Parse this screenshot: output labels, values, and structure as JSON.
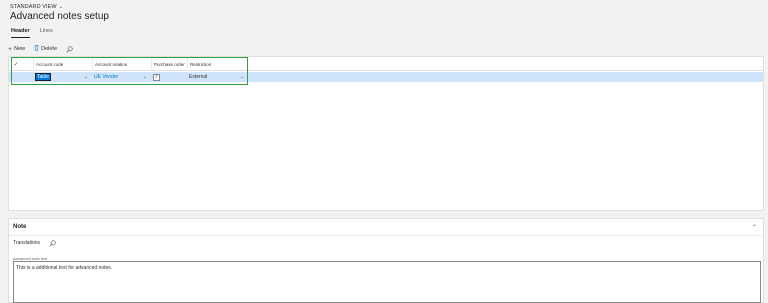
{
  "header": {
    "view_label": "STANDARD VIEW",
    "title": "Advanced notes setup"
  },
  "tabs": [
    {
      "label": "Header",
      "active": true
    },
    {
      "label": "Lines",
      "active": false
    }
  ],
  "toolbar": {
    "new_label": "New",
    "delete_label": "Delete"
  },
  "grid": {
    "columns": [
      "Account code",
      "Account relation",
      "Purchase order",
      "Restriction"
    ],
    "rows": [
      {
        "account_code": "Table",
        "account_relation": "UE Vendor",
        "purchase_order_checked": true,
        "restriction": "External"
      }
    ]
  },
  "note": {
    "title": "Note",
    "toolbar_label": "Translations",
    "field_label": "Advanced note text",
    "text": "This is a additional text for advanced notes."
  },
  "colors": {
    "accent": "#0078d4",
    "selected_row": "#cfe4fa",
    "highlight_box": "#2ea043"
  }
}
